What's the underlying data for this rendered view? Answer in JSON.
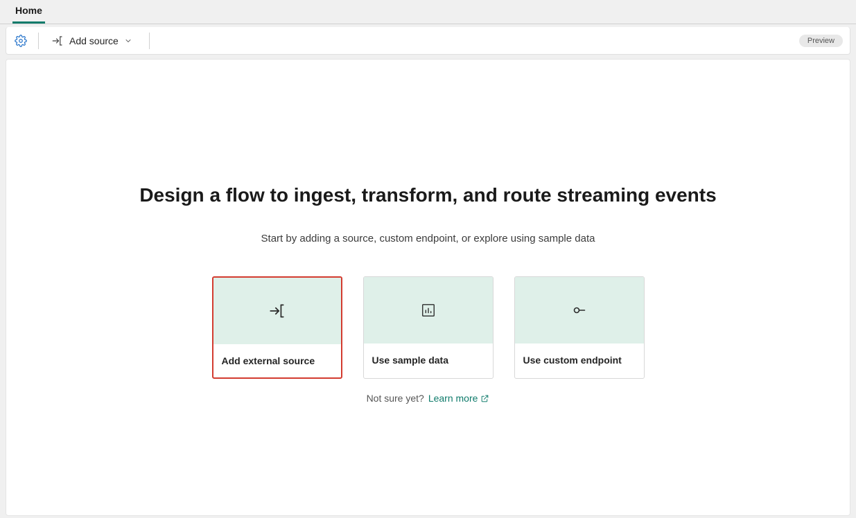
{
  "tabs": {
    "home": "Home"
  },
  "toolbar": {
    "add_source": "Add source",
    "preview_badge": "Preview"
  },
  "main": {
    "headline": "Design a flow to ingest, transform, and route streaming events",
    "subline": "Start by adding a source, custom endpoint, or explore using sample data",
    "cards": {
      "external": "Add external source",
      "sample": "Use sample data",
      "custom": "Use custom endpoint"
    },
    "footer": {
      "not_sure": "Not sure yet?",
      "learn_more": "Learn more"
    }
  }
}
